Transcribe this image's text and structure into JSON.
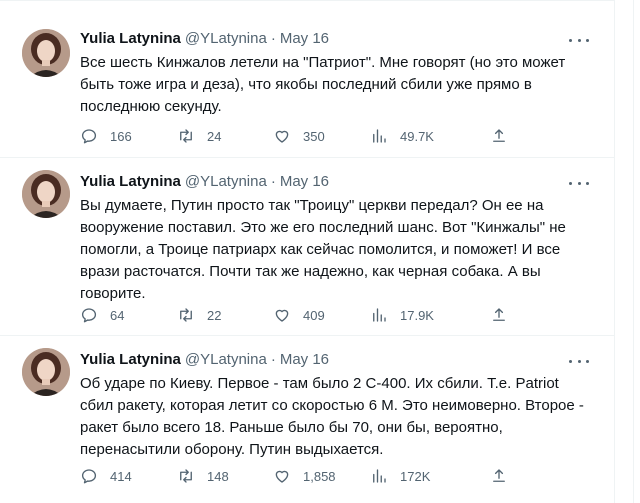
{
  "tweets": [
    {
      "author_name": "Yulia Latynina",
      "author_handle": "@YLatynina",
      "separator": "·",
      "date": "May 16",
      "text": "Все шесть Кинжалов летели на \"Патриот\". Мне говорят (но это может\nбыть тоже игра и деза), что якобы последний сбили уже прямо в\nпоследнюю секунду.",
      "replies": "166",
      "retweets": "24",
      "likes": "350",
      "views": "49.7K"
    },
    {
      "author_name": "Yulia Latynina",
      "author_handle": "@YLatynina",
      "separator": "·",
      "date": "May 16",
      "text": "Вы думаете, Путин просто так \"Троицу\" церкви передал? Он ее на\nвооружение поставил. Это же его последний шанс. Вот \"Кинжалы\" не\nпомогли, а Троице патриарх как сейчас помолится, и поможет! И все\nврази расточатся. Почти так же надежно, как черная собака. А вы\nговорите.",
      "replies": "64",
      "retweets": "22",
      "likes": "409",
      "views": "17.9K"
    },
    {
      "author_name": "Yulia Latynina",
      "author_handle": "@YLatynina",
      "separator": "·",
      "date": "May 16",
      "text": "Об ударе по Киеву. Первое - там было 2 С-400. Их сбили. Т.е. Patriot\nсбил ракету, которая летит со скоростью 6 М. Это неимоверно. Второе -\nракет было всего 18. Раньше было бы 70, они бы, вероятно,\nперенасытили оборону. Путин выдыхается.",
      "replies": "414",
      "retweets": "148",
      "likes": "1,858",
      "views": "172K"
    }
  ],
  "colors": {
    "text": "#0f1419",
    "secondary": "#536471",
    "border": "#eff3f4"
  },
  "icons": [
    "more-icon",
    "reply-icon",
    "retweet-icon",
    "like-icon",
    "views-icon",
    "share-icon"
  ]
}
